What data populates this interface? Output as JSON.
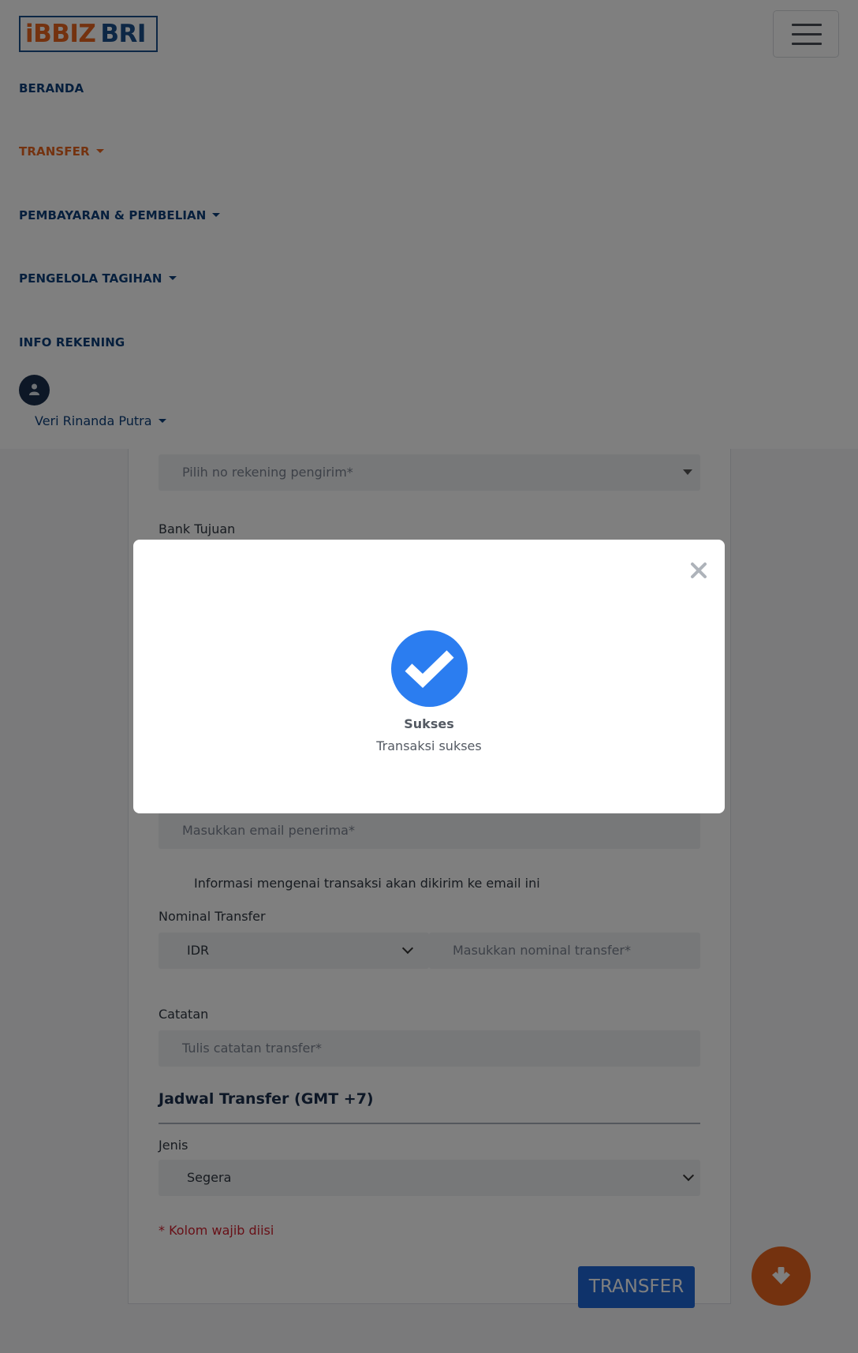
{
  "header": {
    "logo_text_i": "iBBIZ",
    "logo_text_bri": "BRI",
    "nav": [
      {
        "label": "BERANDA"
      },
      {
        "label": "TRANSFER"
      },
      {
        "label": "PEMBAYARAN & PEMBELIAN"
      },
      {
        "label": "PENGELOLA TAGIHAN"
      },
      {
        "label": "INFO REKENING"
      }
    ],
    "active_nav": "TRANSFER",
    "user_name": "Veri Rinanda Putra"
  },
  "form": {
    "source_account_placeholder": "Pilih no rekening pengirim*",
    "bank_label": "Bank Tujuan",
    "email_placeholder": "Masukkan email penerima*",
    "email_note": "Informasi mengenai transaksi akan dikirim ke email ini",
    "nominal_label": "Nominal Transfer",
    "currency": "IDR",
    "nominal_placeholder": "Masukkan nominal transfer*",
    "note_label": "Catatan",
    "note_placeholder": "Tulis catatan transfer*",
    "schedule_title": "Jadwal Transfer (GMT +7)",
    "type_label": "Jenis",
    "type_value": "Segera",
    "required_note": "* Kolom wajib diisi",
    "submit_label": "TRANSFER"
  },
  "modal": {
    "title": "Sukses",
    "message": "Transaksi sukses"
  },
  "colors": {
    "brand_blue": "#0c3f7a",
    "brand_orange": "#e8651f",
    "success_blue": "#2b7df0",
    "button_blue": "#1f66d6",
    "error_red": "#d0202e"
  }
}
